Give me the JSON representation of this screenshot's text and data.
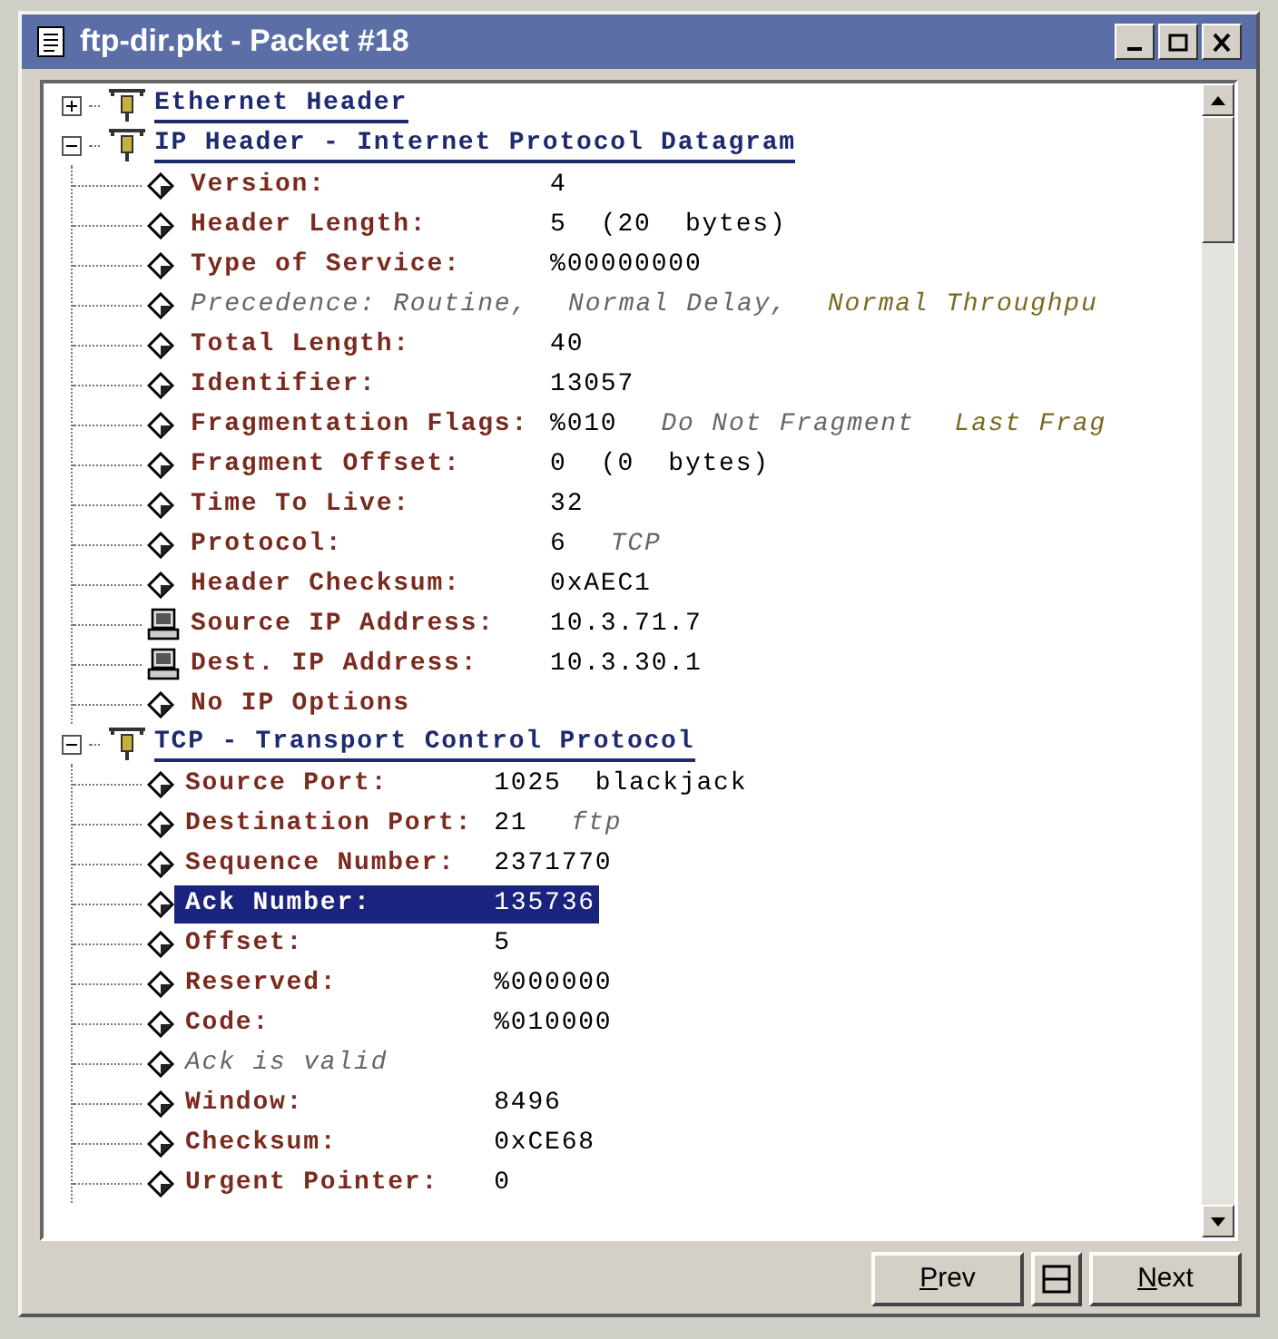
{
  "window": {
    "title": "ftp-dir.pkt - Packet #18"
  },
  "tree": [
    {
      "title": "Ethernet Header",
      "expanded": false
    },
    {
      "title": "IP Header - Internet Protocol Datagram",
      "expanded": true,
      "children": [
        {
          "kind": "field",
          "label": "Version:",
          "value": "4",
          "selected": false
        },
        {
          "kind": "field",
          "label": "Header Length:",
          "value": "5  (20  bytes)",
          "selected": false
        },
        {
          "kind": "field",
          "label": "Type of Service:",
          "value": "%00000000",
          "selected": false
        },
        {
          "kind": "note",
          "notes": [
            "Precedence: Routine,",
            "Normal Delay,",
            "Normal Throughpu"
          ],
          "selected": false
        },
        {
          "kind": "field",
          "label": "Total Length:",
          "value": "40",
          "selected": false
        },
        {
          "kind": "field",
          "label": "Identifier:",
          "value": "13057",
          "selected": false
        },
        {
          "kind": "field",
          "label": "Fragmentation Flags:",
          "value": "%010",
          "notes": [
            "Do Not Fragment",
            "Last Frag"
          ],
          "selected": false
        },
        {
          "kind": "field",
          "label": "Fragment Offset:",
          "value": "0  (0  bytes)",
          "selected": false
        },
        {
          "kind": "field",
          "label": "Time To Live:",
          "value": "32",
          "selected": false
        },
        {
          "kind": "field",
          "label": "Protocol:",
          "value": "6",
          "notes": [
            "TCP"
          ],
          "selected": false
        },
        {
          "kind": "field",
          "label": "Header Checksum:",
          "value": "0xAEC1",
          "selected": false
        },
        {
          "kind": "address",
          "label": "Source IP Address:",
          "value": "10.3.71.7",
          "selected": false
        },
        {
          "kind": "address",
          "label": "Dest. IP Address:",
          "value": "10.3.30.1",
          "selected": false
        },
        {
          "kind": "field",
          "label": "No IP Options",
          "selected": false
        }
      ]
    },
    {
      "title": "TCP - Transport Control Protocol",
      "expanded": true,
      "children": [
        {
          "kind": "field",
          "label": "Source Port:",
          "value": "1025  blackjack",
          "selected": false
        },
        {
          "kind": "field",
          "label": "Destination Port:",
          "value": "21",
          "notes": [
            "ftp"
          ],
          "selected": false
        },
        {
          "kind": "field",
          "label": "Sequence Number:",
          "value": "2371770",
          "selected": false
        },
        {
          "kind": "field",
          "label": "Ack Number:",
          "value": "135736",
          "selected": true
        },
        {
          "kind": "field",
          "label": "Offset:",
          "value": "5",
          "selected": false
        },
        {
          "kind": "field",
          "label": "Reserved:",
          "value": "%000000",
          "selected": false
        },
        {
          "kind": "field",
          "label": "Code:",
          "value": "%010000",
          "selected": false
        },
        {
          "kind": "note",
          "notes": [
            "Ack is valid"
          ],
          "selected": false
        },
        {
          "kind": "field",
          "label": "Window:",
          "value": "8496",
          "selected": false
        },
        {
          "kind": "field",
          "label": "Checksum:",
          "value": "0xCE68",
          "selected": false
        },
        {
          "kind": "field",
          "label": "Urgent Pointer:",
          "value": "0",
          "selected": false
        }
      ]
    }
  ],
  "buttons": [
    {
      "kind": "text",
      "label": "Prev"
    },
    {
      "kind": "split"
    },
    {
      "kind": "text",
      "label": "Next"
    }
  ]
}
